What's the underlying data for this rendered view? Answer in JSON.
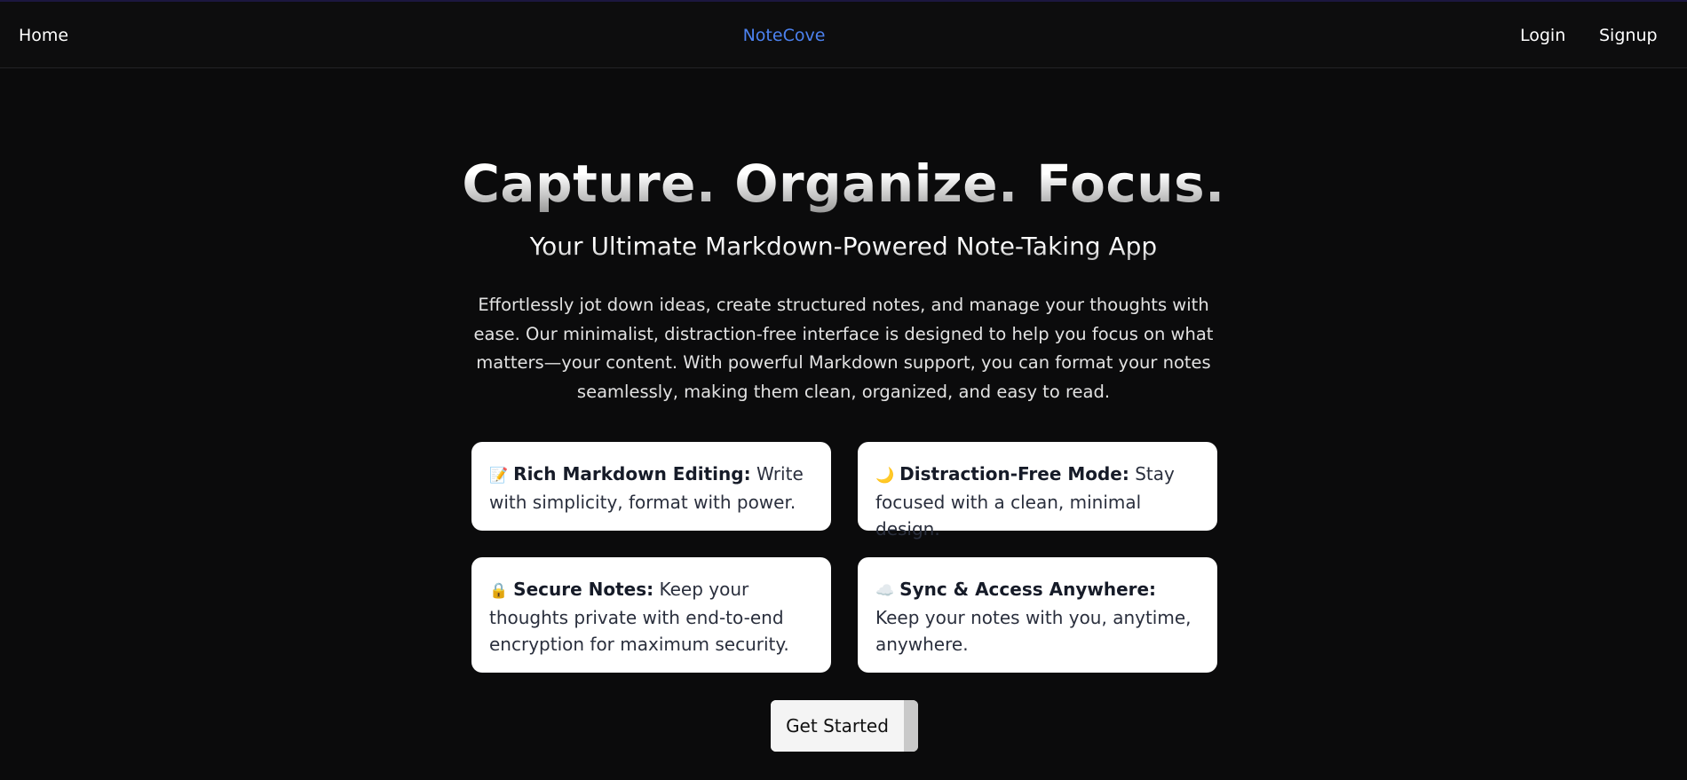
{
  "nav": {
    "home_label": "Home",
    "brand": "NoteCove",
    "login_label": "Login",
    "signup_label": "Signup"
  },
  "hero": {
    "title": "Capture. Organize. Focus.",
    "subtitle": "Your Ultimate Markdown-Powered Note-Taking App",
    "description": "Effortlessly jot down ideas, create structured notes, and manage your thoughts with ease. Our minimalist, distraction-free interface is designed to help you focus on what matters—your content. With powerful Markdown support, you can format your notes seamlessly, making them clean, organized, and easy to read."
  },
  "features": [
    {
      "icon": "memo-icon",
      "emoji": "📝",
      "title": "Rich Markdown Editing:",
      "text": "Write with simplicity, format with power."
    },
    {
      "icon": "moon-icon",
      "emoji": "🌙",
      "title": "Distraction-Free Mode:",
      "text": "Stay focused with a clean, minimal design."
    },
    {
      "icon": "lock-icon",
      "emoji": "🔒",
      "title": "Secure Notes:",
      "text": "Keep your thoughts private with end-to-end encryption for maximum security."
    },
    {
      "icon": "cloud-icon",
      "emoji": "☁️",
      "title": "Sync & Access Anywhere:",
      "text": "Keep your notes with you, anytime, anywhere."
    }
  ],
  "cta": {
    "label": "Get Started"
  },
  "colors": {
    "background": "#0b0b0c",
    "brand": "#4c82f0",
    "card": "#ffffff",
    "button": "#f4f4f4"
  }
}
